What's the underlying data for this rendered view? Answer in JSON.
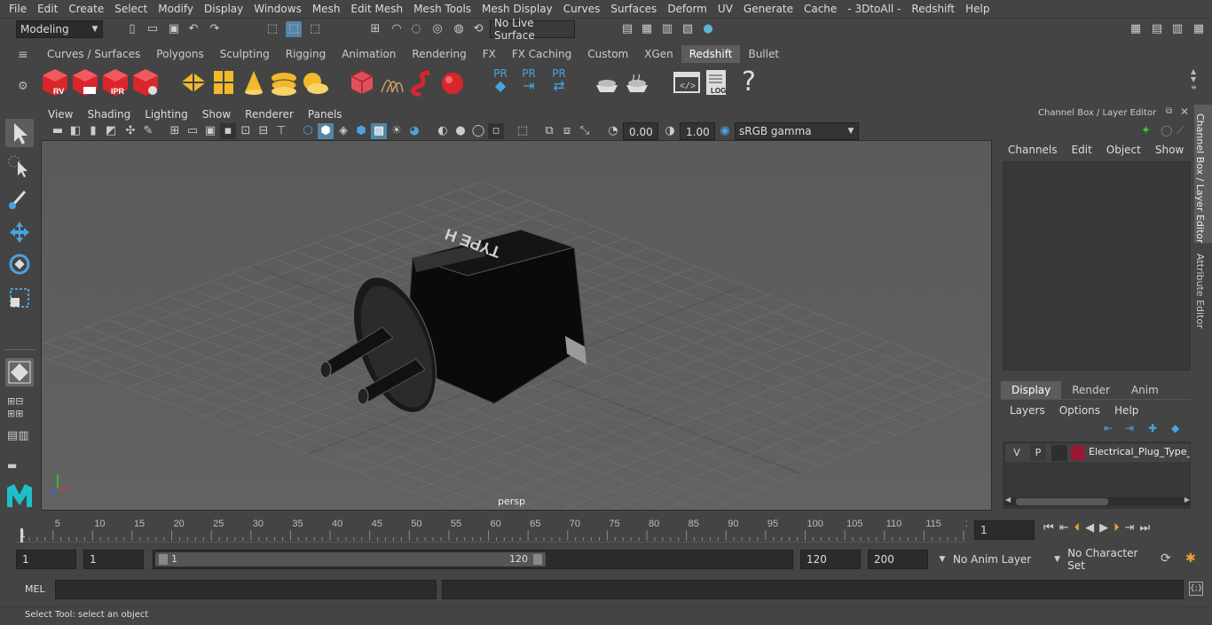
{
  "menubar": [
    "File",
    "Edit",
    "Create",
    "Select",
    "Modify",
    "Display",
    "Windows",
    "Mesh",
    "Edit Mesh",
    "Mesh Tools",
    "Mesh Display",
    "Curves",
    "Surfaces",
    "Deform",
    "UV",
    "Generate",
    "Cache",
    "- 3DtoAll -",
    "Redshift",
    "Help"
  ],
  "statusline": {
    "mode": "Modeling",
    "live_surface": "No Live Surface"
  },
  "shelf_tabs": [
    "Curves / Surfaces",
    "Polygons",
    "Sculpting",
    "Rigging",
    "Animation",
    "Rendering",
    "FX",
    "FX Caching",
    "Custom",
    "XGen",
    "Redshift",
    "Bullet"
  ],
  "shelf_active": "Redshift",
  "shelf_labels": {
    "rv": "RV",
    "ipr": "IPR",
    "pr1": "PR",
    "pr2": "PR",
    "pr3": "PR",
    "log": "LOG",
    "help": "?"
  },
  "viewport": {
    "menus": [
      "View",
      "Shading",
      "Lighting",
      "Show",
      "Renderer",
      "Panels"
    ],
    "exposure": "0.00",
    "gamma": "1.00",
    "colorspace": "sRGB gamma",
    "camera": "persp",
    "model_label": "TYPE H"
  },
  "channelbox": {
    "title": "Channel Box / Layer Editor",
    "menus": [
      "Channels",
      "Edit",
      "Object",
      "Show"
    ]
  },
  "layer_editor": {
    "tabs": [
      "Display",
      "Render",
      "Anim"
    ],
    "active_tab": "Display",
    "menus": [
      "Layers",
      "Options",
      "Help"
    ],
    "layer": {
      "v": "V",
      "p": "P",
      "name": "Electrical_Plug_Type_H",
      "color": "#9b1832"
    }
  },
  "side_tabs": [
    "Channel Box / Layer Editor",
    "Attribute Editor"
  ],
  "timeline": {
    "ticks": [
      "5",
      "10",
      "15",
      "20",
      "25",
      "30",
      "35",
      "40",
      "45",
      "50",
      "55",
      "60",
      "65",
      "70",
      "75",
      "80",
      "85",
      "90",
      "95",
      "100",
      "105",
      "110",
      "115",
      "12"
    ],
    "start_label": "1",
    "current_frame": "1"
  },
  "range": {
    "start": "1",
    "anim_start": "1",
    "slider_start": "1",
    "slider_end": "120",
    "end": "120",
    "anim_end": "200",
    "anim_layer": "No Anim Layer",
    "char_set": "No Character Set"
  },
  "cmdline": {
    "label": "MEL"
  },
  "helpline": {
    "text": "Select Tool: select an object"
  }
}
